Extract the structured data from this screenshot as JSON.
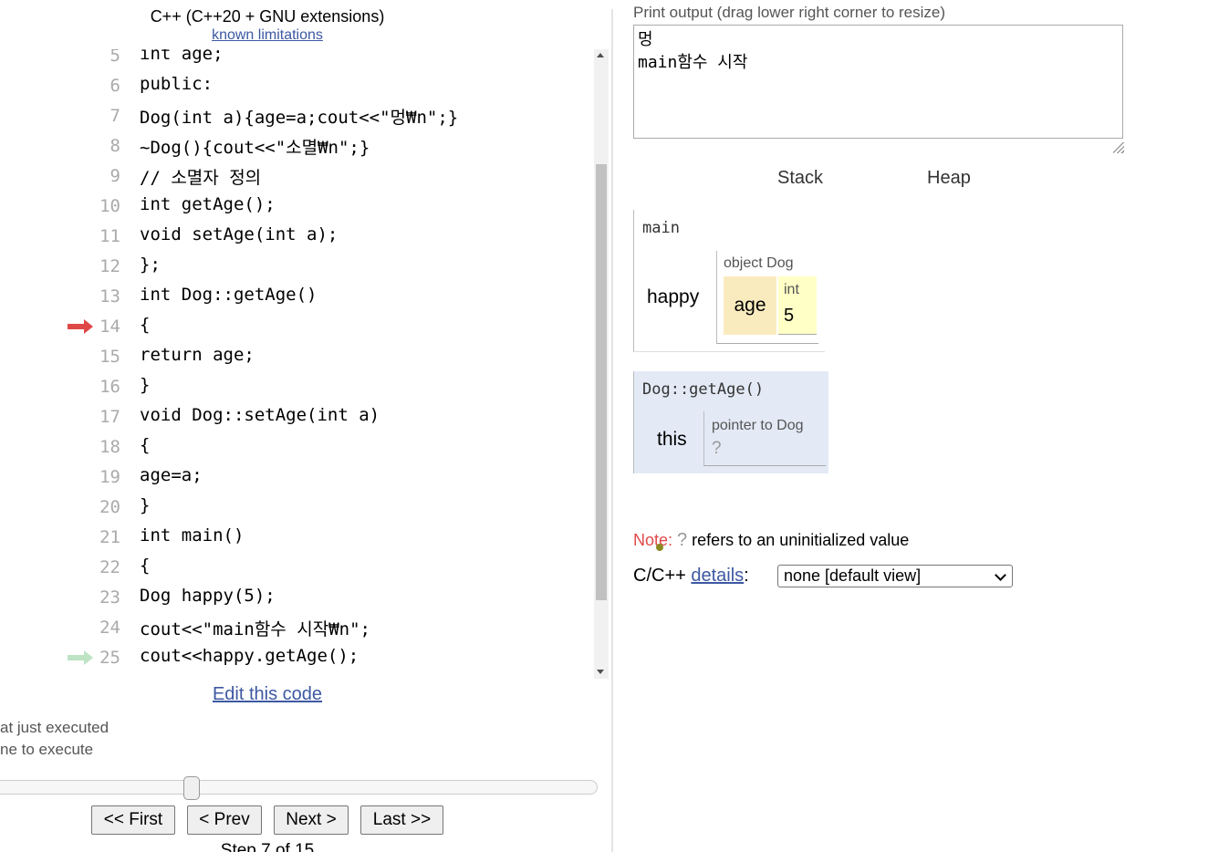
{
  "header": {
    "language": "C++ (C++20 + GNU extensions)",
    "limitations_link": "known limitations"
  },
  "code": {
    "lines": [
      {
        "num": "5",
        "text": "int age;",
        "arrow": "none"
      },
      {
        "num": "6",
        "text": "public:",
        "arrow": "none"
      },
      {
        "num": "7",
        "text": "Dog(int a){age=a;cout<<\"멍₩n\";}",
        "arrow": "none"
      },
      {
        "num": "8",
        "text": "~Dog(){cout<<\"소멸₩n\";}",
        "arrow": "none"
      },
      {
        "num": "9",
        "text": "// 소멸자 정의",
        "arrow": "none"
      },
      {
        "num": "10",
        "text": "int getAge();",
        "arrow": "none"
      },
      {
        "num": "11",
        "text": "void setAge(int a);",
        "arrow": "none"
      },
      {
        "num": "12",
        "text": "};",
        "arrow": "none"
      },
      {
        "num": "13",
        "text": "int Dog::getAge()",
        "arrow": "none"
      },
      {
        "num": "14",
        "text": "{",
        "arrow": "next"
      },
      {
        "num": "15",
        "text": "return age;",
        "arrow": "none"
      },
      {
        "num": "16",
        "text": "}",
        "arrow": "none"
      },
      {
        "num": "17",
        "text": "void Dog::setAge(int a)",
        "arrow": "none"
      },
      {
        "num": "18",
        "text": "{",
        "arrow": "none"
      },
      {
        "num": "19",
        "text": "age=a;",
        "arrow": "none"
      },
      {
        "num": "20",
        "text": "}",
        "arrow": "none"
      },
      {
        "num": "21",
        "text": "int main()",
        "arrow": "none"
      },
      {
        "num": "22",
        "text": "{",
        "arrow": "none"
      },
      {
        "num": "23",
        "text": "Dog happy(5);",
        "arrow": "none"
      },
      {
        "num": "24",
        "text": "cout<<\"main함수 시작₩n\";",
        "arrow": "none"
      },
      {
        "num": "25",
        "text": "cout<<happy.getAge();",
        "arrow": "executed"
      }
    ],
    "arrow_colors": {
      "next": "#e04848",
      "executed": "#bde3c4"
    },
    "edit_link": "Edit this code"
  },
  "legend": {
    "executed": "at just executed",
    "next": "ne to execute"
  },
  "navigation": {
    "first": "<< First",
    "prev": "< Prev",
    "next": "Next >",
    "last": "Last >>",
    "step": "Step 7 of 15"
  },
  "output": {
    "label": "Print output (drag lower right corner to resize)",
    "text": "멍\nmain함수 시작"
  },
  "viz": {
    "stack_heading": "Stack",
    "heap_heading": "Heap",
    "frames": {
      "main": {
        "name": "main",
        "var": "happy",
        "obj_type": "object Dog",
        "field_name": "age",
        "field_type": "int",
        "field_value": "5"
      },
      "getage": {
        "name": "Dog::getAge()",
        "var": "this",
        "ptr_type": "pointer to Dog",
        "ptr_value": "?"
      }
    }
  },
  "note": {
    "label": "Note:",
    "symbol": "?",
    "text": " refers to an uninitialized value"
  },
  "details": {
    "prefix": "C/C++ ",
    "link": "details",
    "suffix": ":",
    "selected": "none [default view]"
  }
}
